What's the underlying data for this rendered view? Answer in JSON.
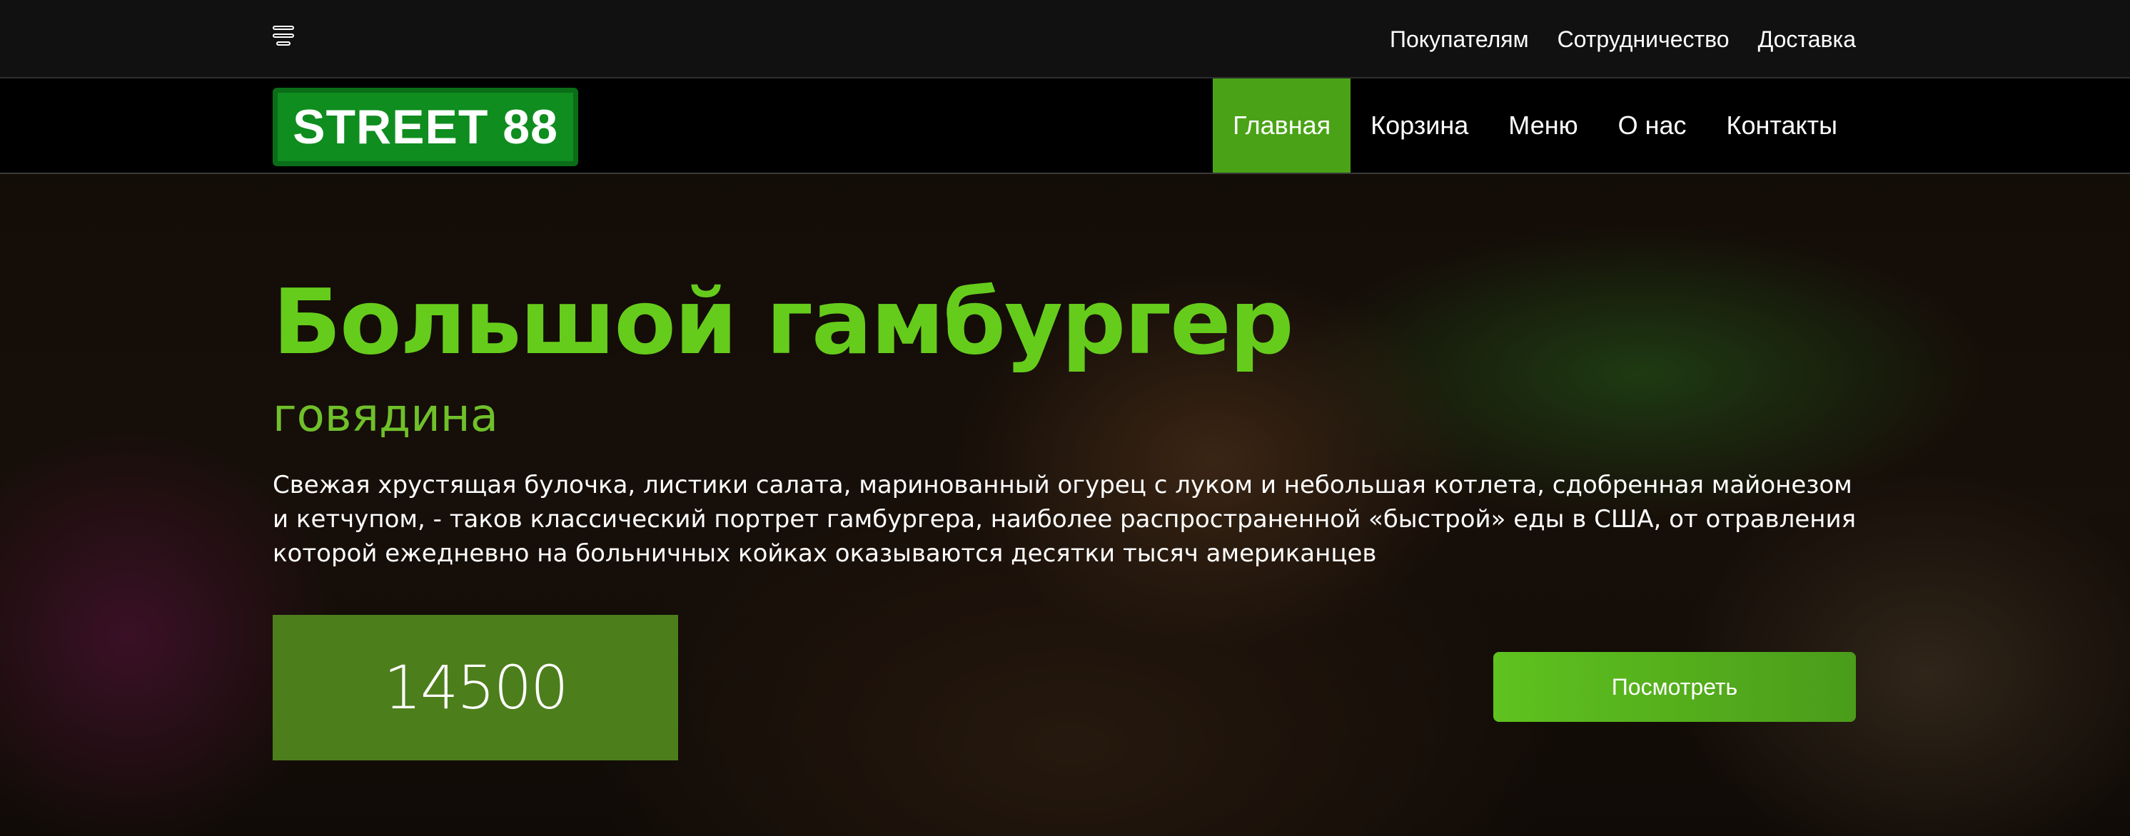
{
  "topbar": {
    "menu_icon": "burger-menu-icon",
    "links": [
      "Покупателям",
      "Сотрудничество",
      "Доставка"
    ]
  },
  "navbar": {
    "logo": "STREET 88",
    "items": [
      {
        "label": "Главная",
        "active": true
      },
      {
        "label": "Корзина"
      },
      {
        "label": "Меню"
      },
      {
        "label": "О нас"
      },
      {
        "label": "Контакты"
      }
    ]
  },
  "hero": {
    "title": "Большой гамбургер",
    "subtitle": "говядина",
    "description": "Свежая хрустящая булочка, листики салата, маринованный огурец с луком и небольшая котлета, сдобренная майонезом и кетчупом, - таков классический портрет гамбургера, наиболее распространенной «быстрой» еды в США, от отравления которой ежедневно на больничных койках оказываются десятки тысяч американцев",
    "price": "14500",
    "button": "Посмотреть"
  },
  "colors": {
    "accent": "#66cc1c",
    "logo_bg": "#0f8d1f",
    "nav_active": "#4aa317",
    "price_bg": "#4d7e1c"
  }
}
